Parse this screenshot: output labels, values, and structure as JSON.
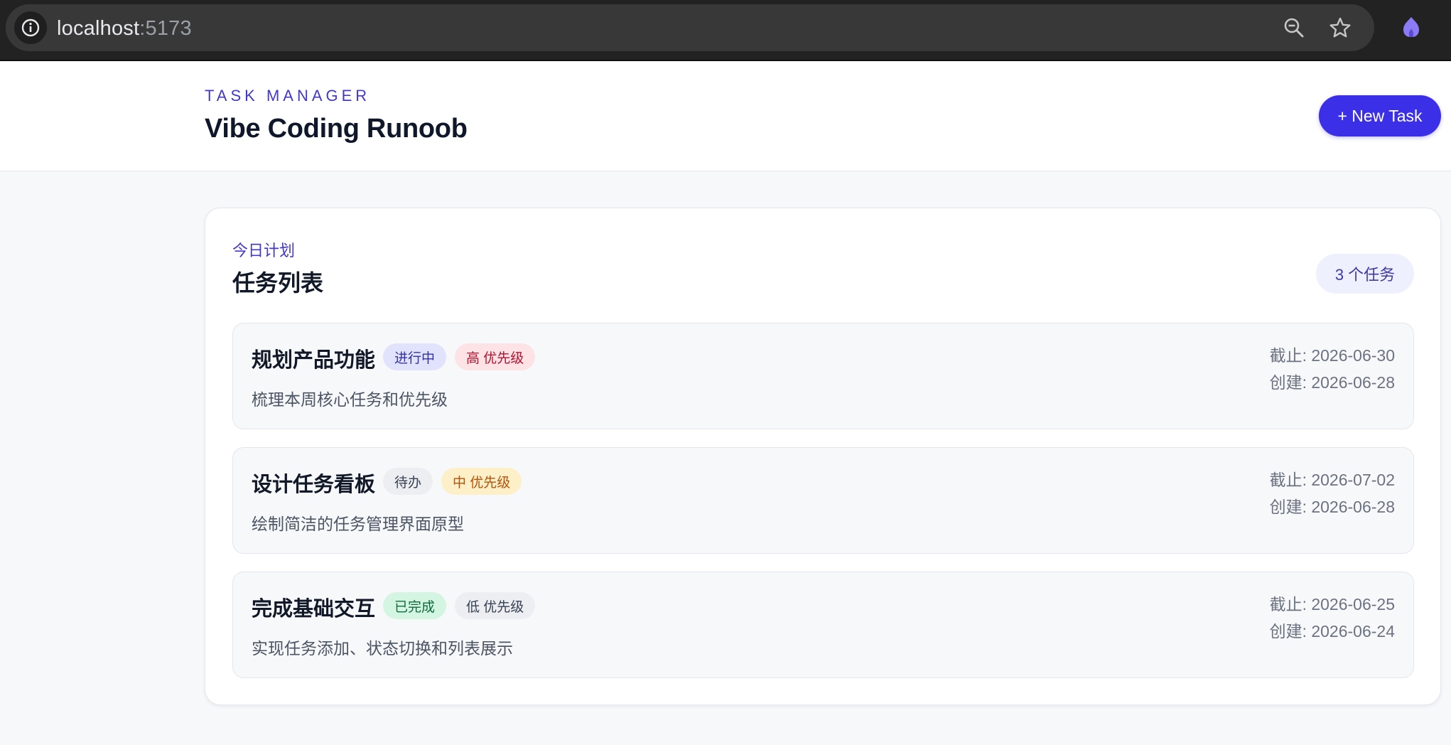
{
  "browser": {
    "url_host": "localhost",
    "url_port": ":5173",
    "icons": [
      "info-icon",
      "zoom-out-icon",
      "star-icon",
      "extension-icon"
    ]
  },
  "header": {
    "eyebrow": "TASK MANAGER",
    "title": "Vibe Coding Runoob",
    "new_task_label": "+ New Task"
  },
  "list": {
    "eyebrow": "今日计划",
    "title": "任务列表",
    "count_label": "3 个任务",
    "tasks": [
      {
        "title": "规划产品功能",
        "status": "进行中",
        "priority": "高 优先级",
        "description": "梳理本周核心任务和优先级",
        "due": "截止: 2026-06-30",
        "created": "创建: 2026-06-28"
      },
      {
        "title": "设计任务看板",
        "status": "待办",
        "priority": "中 优先级",
        "description": "绘制简洁的任务管理界面原型",
        "due": "截止: 2026-07-02",
        "created": "创建: 2026-06-28"
      },
      {
        "title": "完成基础交互",
        "status": "已完成",
        "priority": "低 优先级",
        "description": "实现任务添加、状态切换和列表展示",
        "due": "截止: 2026-06-25",
        "created": "创建: 2026-06-24"
      }
    ]
  },
  "colors": {
    "accent": "#3b2fe8",
    "status_in_progress_bg": "#e0e3fb",
    "status_in_progress_fg": "#3730a3",
    "status_todo_bg": "#eceef2",
    "status_todo_fg": "#374151",
    "status_done_bg": "#d5f5e3",
    "status_done_fg": "#0f6b3c",
    "priority_high_bg": "#fde2e6",
    "priority_high_fg": "#b4122f",
    "priority_mid_bg": "#fdefc8",
    "priority_mid_fg": "#b45309",
    "priority_low_bg": "#eceef2",
    "priority_low_fg": "#374151"
  }
}
